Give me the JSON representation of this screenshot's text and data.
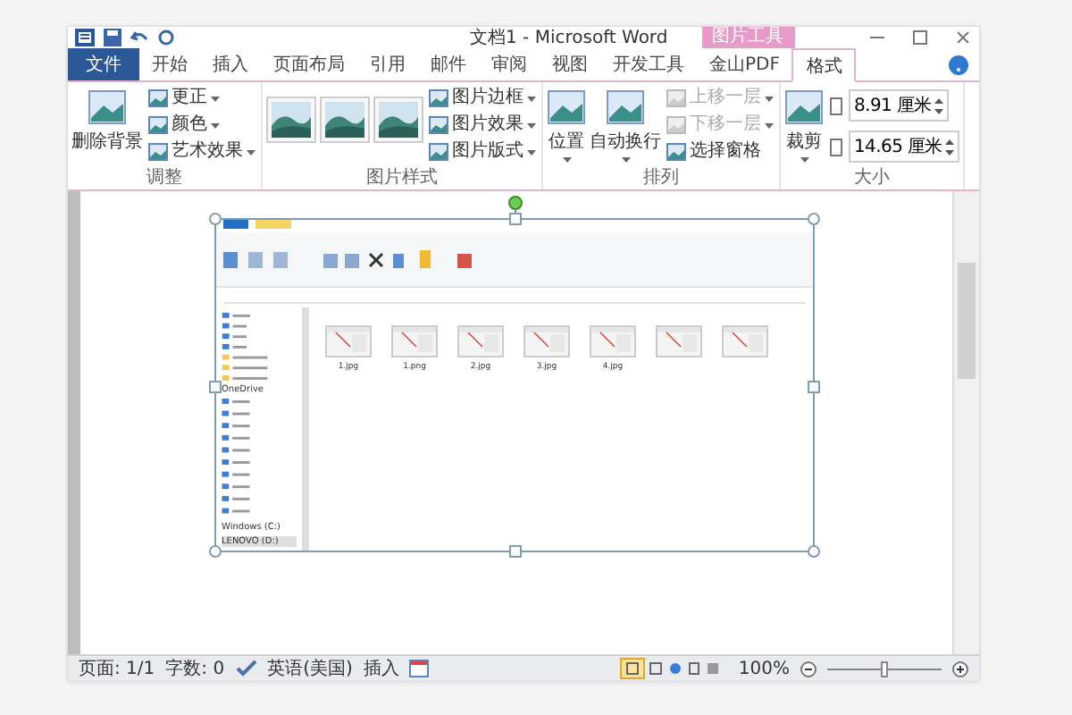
{
  "window": {
    "title": "文档1 - Microsoft Word",
    "contextual_tab": "图片工具"
  },
  "tabs": [
    {
      "label": "文件",
      "kind": "file",
      "selected": false
    },
    {
      "label": "开始",
      "kind": "normal",
      "selected": false
    },
    {
      "label": "插入",
      "kind": "normal",
      "selected": false
    },
    {
      "label": "页面布局",
      "kind": "normal",
      "selected": false
    },
    {
      "label": "引用",
      "kind": "normal",
      "selected": false
    },
    {
      "label": "邮件",
      "kind": "normal",
      "selected": false
    },
    {
      "label": "审阅",
      "kind": "normal",
      "selected": false
    },
    {
      "label": "视图",
      "kind": "normal",
      "selected": false
    },
    {
      "label": "开发工具",
      "kind": "normal",
      "selected": false
    },
    {
      "label": "金山PDF",
      "kind": "normal",
      "selected": false
    },
    {
      "label": "格式",
      "kind": "normal",
      "selected": true
    }
  ],
  "ribbon": [
    {
      "label": "调整",
      "columns": [
        [
          {
            "kind": "large",
            "label": "删除背景",
            "dropdown": false
          }
        ],
        [
          {
            "kind": "small",
            "label": "更正",
            "dropdown": true,
            "disabled": false
          },
          {
            "kind": "small",
            "label": "颜色",
            "dropdown": true,
            "disabled": false
          },
          {
            "kind": "small",
            "label": "艺术效果",
            "dropdown": true,
            "disabled": false
          }
        ]
      ]
    },
    {
      "label": "图片样式",
      "columns": [
        [
          {
            "kind": "thumb"
          }
        ],
        [
          {
            "kind": "thumb"
          }
        ],
        [
          {
            "kind": "thumb"
          }
        ],
        [
          {
            "kind": "small",
            "label": "图片边框",
            "dropdown": true,
            "disabled": false
          },
          {
            "kind": "small",
            "label": "图片效果",
            "dropdown": true,
            "disabled": false
          },
          {
            "kind": "small",
            "label": "图片版式",
            "dropdown": true,
            "disabled": false
          }
        ]
      ]
    },
    {
      "label": "排列",
      "columns": [
        [
          {
            "kind": "large",
            "label": "位置",
            "dropdown": true
          }
        ],
        [
          {
            "kind": "large",
            "label": "自动换行",
            "dropdown": true
          }
        ],
        [
          {
            "kind": "small",
            "label": "上移一层",
            "dropdown": true,
            "disabled": true
          },
          {
            "kind": "small",
            "label": "下移一层",
            "dropdown": true,
            "disabled": true
          },
          {
            "kind": "small",
            "label": "选择窗格",
            "dropdown": false,
            "disabled": false
          }
        ]
      ]
    },
    {
      "label": "大小",
      "columns": [
        [
          {
            "kind": "large",
            "label": "裁剪",
            "dropdown": true
          }
        ],
        [
          {
            "kind": "spin",
            "label": "8.91 厘米"
          },
          {
            "kind": "spin",
            "label": "14.65 厘米"
          }
        ]
      ]
    }
  ],
  "embedded": {
    "files": [
      "1.jpg",
      "1.png",
      "2.jpg",
      "3.jpg",
      "4.jpg"
    ],
    "drives": [
      {
        "label": "OneDrive",
        "selected": false
      },
      {
        "label": "Windows (C:)",
        "selected": false
      },
      {
        "label": "LENOVO (D:)",
        "selected": true
      }
    ]
  },
  "status": {
    "items": [
      "页面: 1/1",
      "字数: 0",
      "英语(美国)",
      "插入"
    ],
    "zoom": "100%",
    "level": 0.5
  }
}
